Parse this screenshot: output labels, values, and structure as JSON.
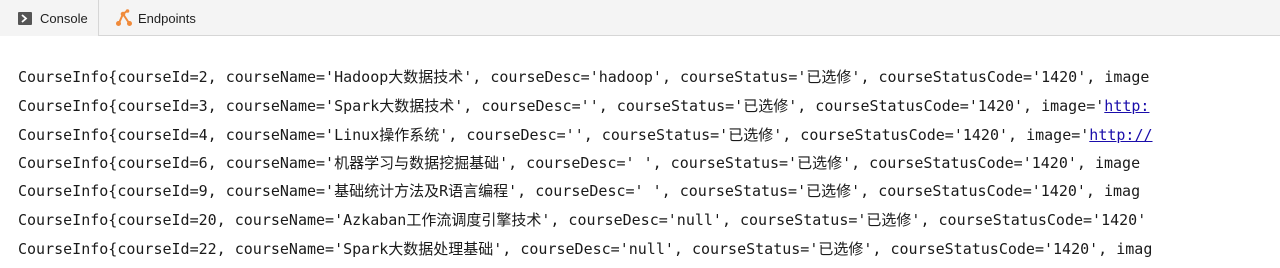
{
  "tabs": [
    {
      "label": "Console",
      "icon": "console-icon"
    },
    {
      "label": "Endpoints",
      "icon": "endpoints-icon"
    }
  ],
  "colors": {
    "console_icon": "#555555",
    "endpoints_icon": "#f08a3a",
    "link": "#1a0dab"
  },
  "console": {
    "lines": [
      {
        "text": "CourseInfo{courseId=2, courseName='Hadoop大数据技术', courseDesc='hadoop', courseStatus='已选修', courseStatusCode='1420', image",
        "link": ""
      },
      {
        "text": "CourseInfo{courseId=3, courseName='Spark大数据技术', courseDesc='', courseStatus='已选修', courseStatusCode='1420', image='",
        "link": "http:"
      },
      {
        "text": "CourseInfo{courseId=4, courseName='Linux操作系统', courseDesc='', courseStatus='已选修', courseStatusCode='1420', image='",
        "link": "http://"
      },
      {
        "text": "CourseInfo{courseId=6, courseName='机器学习与数据挖掘基础', courseDesc=' ', courseStatus='已选修', courseStatusCode='1420', image",
        "link": ""
      },
      {
        "text": "CourseInfo{courseId=9, courseName='基础统计方法及R语言编程', courseDesc=' ', courseStatus='已选修', courseStatusCode='1420', imag",
        "link": ""
      },
      {
        "text": "CourseInfo{courseId=20, courseName='Azkaban工作流调度引擎技术', courseDesc='null', courseStatus='已选修', courseStatusCode='1420'",
        "link": ""
      },
      {
        "text": "CourseInfo{courseId=22, courseName='Spark大数据处理基础', courseDesc='null', courseStatus='已选修', courseStatusCode='1420', imag",
        "link": ""
      }
    ]
  }
}
